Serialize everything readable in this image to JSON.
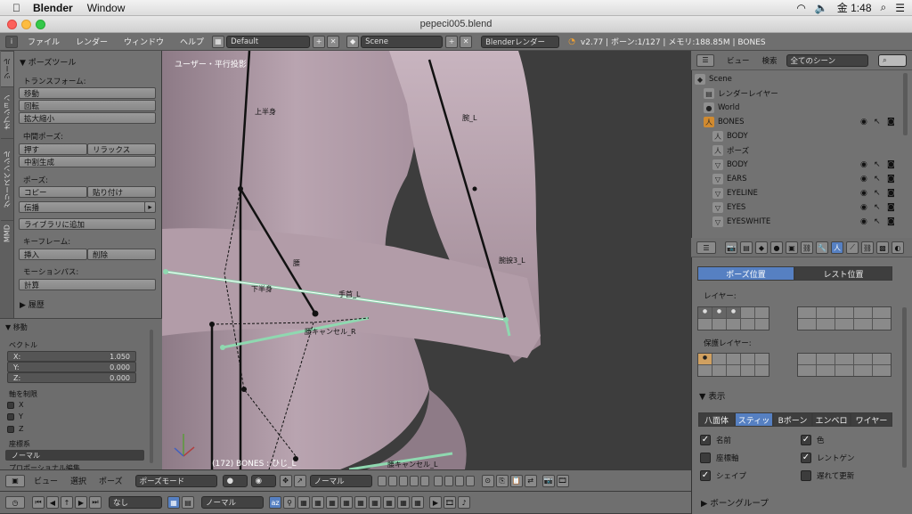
{
  "macbar": {
    "app": "Blender",
    "window_menu": "Window",
    "clock": "金 1:48"
  },
  "window": {
    "title": "pepeci005.blend"
  },
  "info_header": {
    "menus": [
      "ファイル",
      "レンダー",
      "ウィンドウ",
      "ヘルプ"
    ],
    "layout": "Default",
    "scene": "Scene",
    "engine": "Blenderレンダー",
    "stats": "v2.77 | ボーン:1/127 | メモリ:188.85M | BONES"
  },
  "tool_shelf": {
    "vertical_tabs": [
      "ツール",
      "オプション",
      "グリースペンシル",
      "MMD"
    ],
    "panel_title": "ポーズツール",
    "transform_label": "トランスフォーム:",
    "transform_buttons": [
      "移動",
      "回転",
      "拡大縮小"
    ],
    "inbetween_label": "中間ポーズ:",
    "push": "押す",
    "relax": "リラックス",
    "breakdowner": "中割生成",
    "pose_label": "ポーズ:",
    "copy": "コピー",
    "paste": "貼り付け",
    "propagate": "伝播",
    "add_library": "ライブラリに追加",
    "keyframe_label": "キーフレーム:",
    "insert": "挿入",
    "delete": "削除",
    "motion_paths_label": "モーションパス:",
    "calculate": "計算",
    "history": "履歴"
  },
  "operator_panel": {
    "title": "移動",
    "vector_label": "ベクトル",
    "x_label": "X:",
    "x_value": "1.050",
    "y_label": "Y:",
    "y_value": "0.000",
    "z_label": "Z:",
    "z_value": "0.000",
    "constraint_label": "軸を制限",
    "axes": [
      "X",
      "Y",
      "Z"
    ],
    "orientation_label": "座標系",
    "orientation_value": "ノーマル",
    "proportional_label": "プロポーショナル編集"
  },
  "viewport": {
    "view_label": "ユーザー・平行投影",
    "status": "(172) BONES : ひじ_L",
    "bone_labels": [
      "上半身",
      "腕_L",
      "腰",
      "腕捩3_L",
      "下半身",
      "手首_L",
      "腰キャンセル_R",
      "腰キャンセル_L"
    ],
    "colors": {
      "background": "#3d3d3d",
      "skin": "#b8a2ad",
      "bone_selected": "#8fd8b0",
      "bone": "#111111"
    }
  },
  "outliner": {
    "view": "ビュー",
    "search": "検索",
    "filter": "全てのシーン",
    "items": [
      {
        "label": "Scene",
        "indent": 0
      },
      {
        "label": "レンダーレイヤー",
        "indent": 1
      },
      {
        "label": "World",
        "indent": 1
      },
      {
        "label": "BONES",
        "indent": 1
      },
      {
        "label": "BODY",
        "indent": 2
      },
      {
        "label": "ポーズ",
        "indent": 2
      },
      {
        "label": "BODY",
        "indent": 2
      },
      {
        "label": "EARS",
        "indent": 2
      },
      {
        "label": "EYELINE",
        "indent": 2
      },
      {
        "label": "EYES",
        "indent": 2
      },
      {
        "label": "EYESWHITE",
        "indent": 2
      }
    ]
  },
  "properties": {
    "pose_position": "ポーズ位置",
    "rest_position": "レスト位置",
    "layers_label": "レイヤー:",
    "protected_layers_label": "保護レイヤー:",
    "display_label": "表示",
    "display_types": [
      "八面体",
      "スティッ",
      "Bボーン",
      "エンベロ",
      "ワイヤー"
    ],
    "active_display_type": "スティッ",
    "options": [
      {
        "label": "名前",
        "checked": true
      },
      {
        "label": "色",
        "checked": true
      },
      {
        "label": "座標軸",
        "checked": false
      },
      {
        "label": "レントゲン",
        "checked": true
      },
      {
        "label": "シェイプ",
        "checked": true
      },
      {
        "label": "遅れて更新",
        "checked": false
      }
    ],
    "bone_groups": "ボーングループ"
  },
  "view3d_header": {
    "menus": [
      "ビュー",
      "選択",
      "ポーズ"
    ],
    "mode": "ポーズモード",
    "orientation": "ノーマル"
  },
  "timeline_header": {
    "keying": "なし",
    "orientation": "ノーマル"
  }
}
